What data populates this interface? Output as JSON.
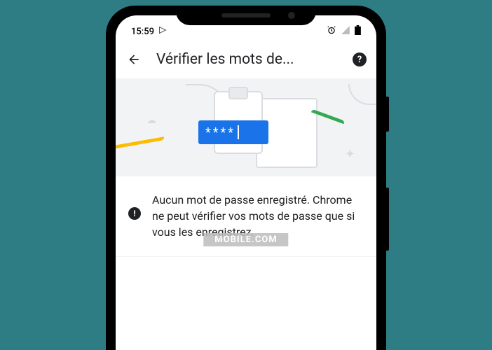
{
  "status_bar": {
    "time": "15:59"
  },
  "app_bar": {
    "title": "Vérifier les mots de..."
  },
  "illustration": {
    "password_mask": "****"
  },
  "message": {
    "text": "Aucun mot de passe enregistré. Chrome ne peut vérifier vos mots de passe que si vous les enregistrez."
  },
  "watermark": {
    "text": "MOBILE.COM"
  }
}
